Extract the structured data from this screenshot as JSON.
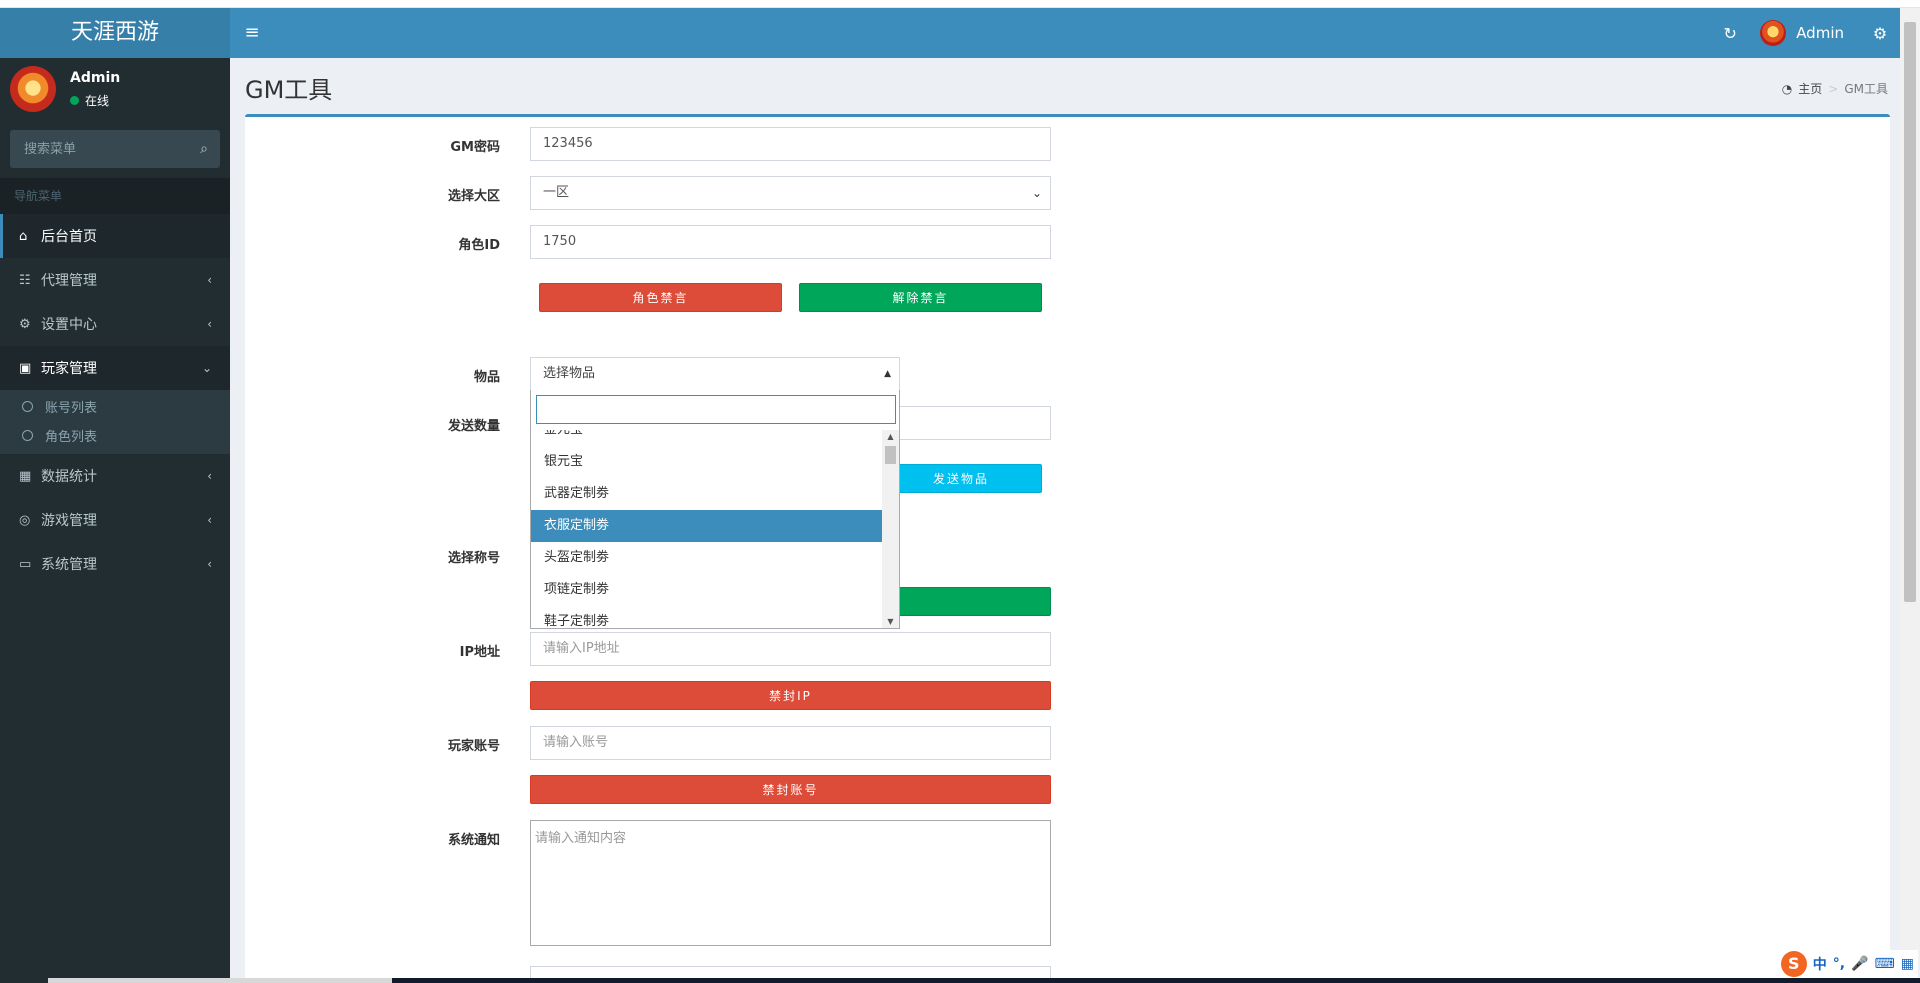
{
  "header": {
    "logo": "天涯西游",
    "toggle": "≡",
    "refresh_icon": "↻",
    "user_name": "Admin",
    "gears_icon": "⚙"
  },
  "sidebar": {
    "user": {
      "name": "Admin",
      "status": "在线"
    },
    "search_placeholder": "搜索菜单",
    "nav_header": "导航菜单",
    "items": [
      {
        "label": "后台首页",
        "icon": "⌂"
      },
      {
        "label": "代理管理",
        "icon": "☷"
      },
      {
        "label": "设置中心",
        "icon": "⚙"
      },
      {
        "label": "玩家管理",
        "icon": "▣"
      },
      {
        "label": "数据统计",
        "icon": "▦"
      },
      {
        "label": "游戏管理",
        "icon": "◎"
      },
      {
        "label": "系统管理",
        "icon": "▭"
      }
    ],
    "sub_items": [
      "账号列表",
      "角色列表"
    ]
  },
  "content": {
    "title": "GM工具",
    "breadcrumb": {
      "home": "主页",
      "current": "GM工具"
    }
  },
  "form": {
    "gm_password": {
      "label": "GM密码",
      "value": "123456"
    },
    "region": {
      "label": "选择大区",
      "value": "一区"
    },
    "role_id": {
      "label": "角色ID",
      "value": "1750"
    },
    "btn_mute": "角色禁言",
    "btn_unmute": "解除禁言",
    "item": {
      "label": "物品",
      "value": "选择物品"
    },
    "send_count": {
      "label": "发送数量"
    },
    "btn_send_item": "发送物品",
    "title_select": {
      "label": "选择称号"
    },
    "ip": {
      "label": "IP地址",
      "placeholder": "请输入IP地址"
    },
    "btn_ban_ip": "禁封IP",
    "account": {
      "label": "玩家账号",
      "placeholder": "请输入账号"
    },
    "btn_ban_account": "禁封账号",
    "notice": {
      "label": "系统通知",
      "placeholder": "请输入通知内容"
    }
  },
  "dropdown": {
    "options": [
      "金元宝",
      "银元宝",
      "武器定制劵",
      "衣服定制劵",
      "头盔定制劵",
      "项链定制劵",
      "鞋子定制劵"
    ],
    "highlighted": "衣服定制劵"
  },
  "ime": {
    "logo": "S",
    "items": [
      "中",
      "°,",
      "🎤",
      "⌨",
      "▦"
    ]
  },
  "colors": {
    "header": "#3c8dbc",
    "sidebar": "#222d32",
    "danger": "#dd4b39",
    "success": "#00a65a",
    "info": "#00c0ef"
  }
}
